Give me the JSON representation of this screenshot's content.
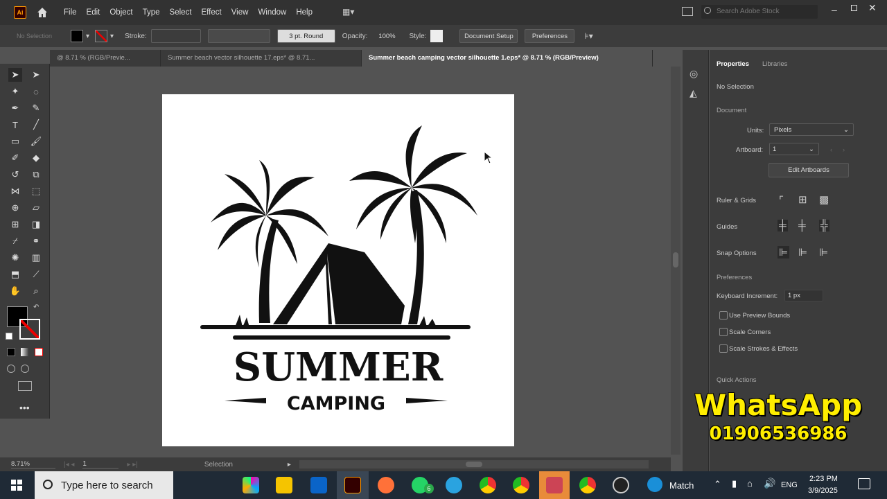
{
  "app": {
    "logo_text": "Ai"
  },
  "menu": [
    "File",
    "Edit",
    "Object",
    "Type",
    "Select",
    "Effect",
    "View",
    "Window",
    "Help"
  ],
  "search": {
    "placeholder": "Search Adobe Stock"
  },
  "control_bar": {
    "selection_label": "No Selection",
    "stroke_label": "Stroke:",
    "brush": "3 pt. Round",
    "opacity_label": "Opacity:",
    "opacity_value": "100%",
    "style_label": "Style:",
    "document_setup": "Document Setup",
    "preferences": "Preferences"
  },
  "tabs": [
    "@ 8.71 % (RGB/Previe...",
    "Summer beach vector silhouette 17.eps* @ 8.71...",
    "Summer beach camping vector silhouette 1.eps* @ 8.71 % (RGB/Preview)"
  ],
  "artwork": {
    "line1": "SUMMER",
    "line2": "CAMPING"
  },
  "properties": {
    "tab_properties": "Properties",
    "tab_libraries": "Libraries",
    "no_selection": "No Selection",
    "document": "Document",
    "units_label": "Units:",
    "units_value": "Pixels",
    "artboard_label": "Artboard:",
    "artboard_value": "1",
    "edit_artboards": "Edit Artboards",
    "ruler_grids": "Ruler & Grids",
    "guides": "Guides",
    "snap_options": "Snap Options",
    "preferences": "Preferences",
    "keyboard_increment_label": "Keyboard Increment:",
    "keyboard_increment_value": "1 px",
    "checkboxes": [
      "Use Preview Bounds",
      "Scale Corners",
      "Scale Strokes & Effects"
    ],
    "quick_actions": "Quick Actions"
  },
  "status": {
    "zoom": "8.71%",
    "artboard": "1",
    "tool": "Selection"
  },
  "taskbar": {
    "search_placeholder": "Type here to search",
    "weather": "Match",
    "lang": "ENG",
    "time": "2:23 PM",
    "date": "3/9/2025",
    "whatsapp_badge": "6"
  },
  "overlay": {
    "title": "WhatsApp",
    "phone": "01906536986"
  },
  "colors": {
    "accent": "#ff9a00",
    "overlay_text": "#ffee00"
  }
}
